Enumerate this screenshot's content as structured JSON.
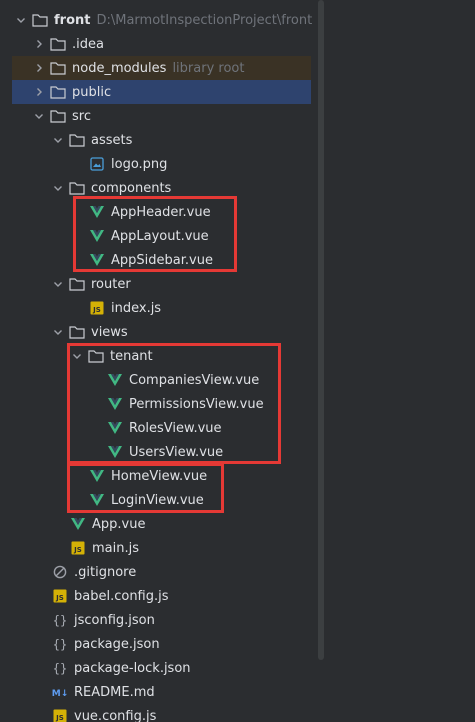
{
  "colors": {
    "background": "#2b2d30",
    "selection": "#2e436e",
    "excluded_row": "#3a3225",
    "text": "#dfe1e5",
    "hint": "#6f737a",
    "folder_icon": "#c9ccd1",
    "vue_icon": "#41b883",
    "js_icon": "#d4b106",
    "highlight_box": "#e53935"
  },
  "project": {
    "name": "front",
    "path": "D:\\MarmotInspectionProject\\front"
  },
  "tree": {
    "idea": ".idea",
    "node_modules": "node_modules",
    "node_modules_hint": "library root",
    "public": "public",
    "src": "src",
    "assets": "assets",
    "logo": "logo.png",
    "components": "components",
    "app_header": "AppHeader.vue",
    "app_layout": "AppLayout.vue",
    "app_sidebar": "AppSidebar.vue",
    "router": "router",
    "router_index": "index.js",
    "views": "views",
    "tenant": "tenant",
    "companies_view": "CompaniesView.vue",
    "permissions_view": "PermissionsView.vue",
    "roles_view": "RolesView.vue",
    "users_view": "UsersView.vue",
    "home_view": "HomeView.vue",
    "login_view": "LoginView.vue",
    "app_vue": "App.vue",
    "main_js": "main.js",
    "gitignore": ".gitignore",
    "babel_config": "babel.config.js",
    "jsconfig": "jsconfig.json",
    "package_json": "package.json",
    "package_lock": "package-lock.json",
    "readme": "README.md",
    "vue_config": "vue.config.js"
  },
  "icons": {
    "vue": "vue-file-icon",
    "js": "js-file-icon",
    "folder": "folder-icon",
    "image": "image-file-icon",
    "json": "json-file-icon",
    "markdown": "markdown-file-icon",
    "ignore": "ignore-file-icon",
    "chevron_right": "chevron-right-icon",
    "chevron_down": "chevron-down-icon"
  }
}
